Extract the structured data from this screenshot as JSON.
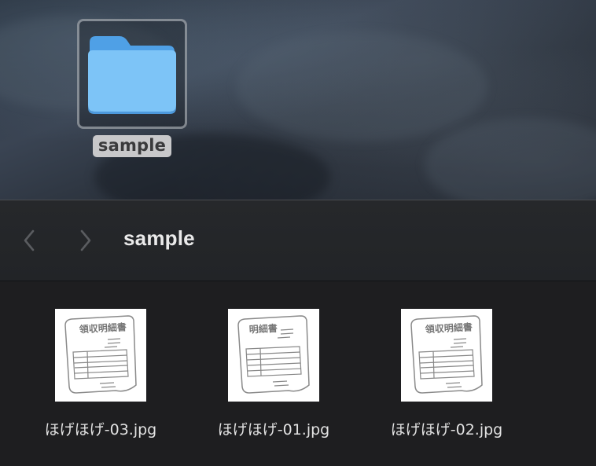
{
  "desktop": {
    "folder": {
      "label": "sample",
      "icon": "folder-icon",
      "color": "#6fb6f0"
    }
  },
  "window": {
    "title": "sample",
    "nav": {
      "back_icon": "chevron-left-icon",
      "forward_icon": "chevron-right-icon"
    },
    "files": [
      {
        "name": "ほげほげ-03.jpg",
        "thumb_heading": "領収明細書"
      },
      {
        "name": "ほげほげ-01.jpg",
        "thumb_heading": "明細書"
      },
      {
        "name": "ほげほげ-02.jpg",
        "thumb_heading": "領収明細書"
      }
    ]
  }
}
